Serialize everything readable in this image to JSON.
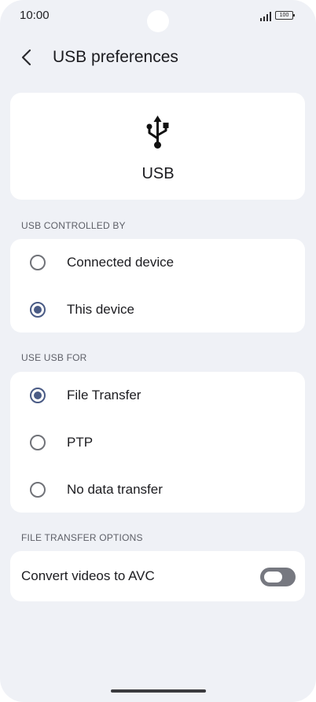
{
  "status_bar": {
    "time": "10:00",
    "battery": "100"
  },
  "header": {
    "title": "USB preferences"
  },
  "usb_card": {
    "label": "USB"
  },
  "controlled_by": {
    "header": "USB CONTROLLED BY",
    "options": [
      {
        "label": "Connected device",
        "selected": false
      },
      {
        "label": "This device",
        "selected": true
      }
    ]
  },
  "use_usb_for": {
    "header": "USE USB FOR",
    "options": [
      {
        "label": "File Transfer",
        "selected": true
      },
      {
        "label": "PTP",
        "selected": false
      },
      {
        "label": "No data transfer",
        "selected": false
      }
    ]
  },
  "file_transfer_options": {
    "header": "FILE TRANSFER OPTIONS",
    "convert_label": "Convert videos to AVC",
    "convert_enabled": false
  },
  "colors": {
    "background": "#eff1f6",
    "card": "#ffffff",
    "accent": "#4a5b85",
    "toggle_off": "#767880"
  }
}
